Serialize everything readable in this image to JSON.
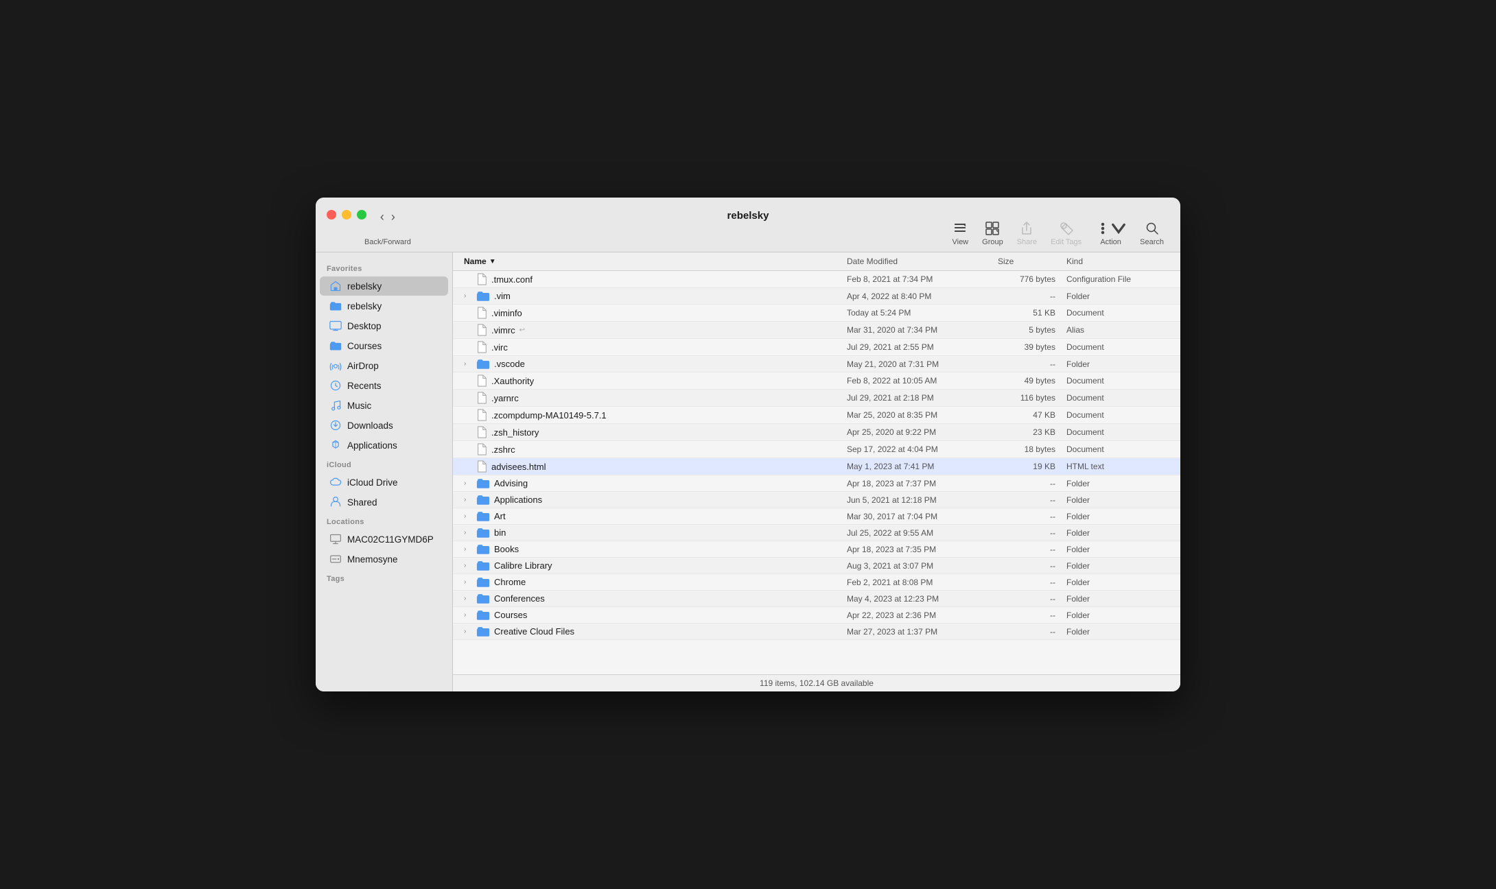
{
  "window": {
    "title": "rebelsky"
  },
  "toolbar": {
    "back_forward_label": "Back/Forward",
    "view_label": "View",
    "group_label": "Group",
    "share_label": "Share",
    "edit_tags_label": "Edit Tags",
    "action_label": "Action",
    "search_label": "Search"
  },
  "sidebar": {
    "favorites_label": "Favorites",
    "icloud_label": "iCloud",
    "locations_label": "Locations",
    "tags_label": "Tags",
    "items": [
      {
        "id": "rebelsky-home",
        "label": "rebelsky",
        "type": "home",
        "active": true
      },
      {
        "id": "rebelsky-folder",
        "label": "rebelsky",
        "type": "folder",
        "active": false
      },
      {
        "id": "desktop",
        "label": "Desktop",
        "type": "desktop",
        "active": false
      },
      {
        "id": "courses",
        "label": "Courses",
        "type": "folder",
        "active": false
      },
      {
        "id": "airdrop",
        "label": "AirDrop",
        "type": "airdrop",
        "active": false
      },
      {
        "id": "recents",
        "label": "Recents",
        "type": "recents",
        "active": false
      },
      {
        "id": "music",
        "label": "Music",
        "type": "music",
        "active": false
      },
      {
        "id": "downloads",
        "label": "Downloads",
        "type": "downloads",
        "active": false
      },
      {
        "id": "applications",
        "label": "Applications",
        "type": "applications",
        "active": false
      }
    ],
    "icloud_items": [
      {
        "id": "icloud-drive",
        "label": "iCloud Drive",
        "type": "cloud"
      },
      {
        "id": "shared",
        "label": "Shared",
        "type": "shared"
      }
    ],
    "location_items": [
      {
        "id": "mac",
        "label": "MAC02C11GYMD6P",
        "type": "computer"
      },
      {
        "id": "mnemosyne",
        "label": "Mnemosyne",
        "type": "drive"
      }
    ]
  },
  "columns": {
    "name": "Name",
    "date_modified": "Date Modified",
    "size": "Size",
    "kind": "Kind"
  },
  "files": [
    {
      "name": ".tmux.conf",
      "date": "Feb 8, 2021 at 7:34 PM",
      "size": "776 bytes",
      "kind": "Configuration File",
      "type": "doc",
      "expanded": false
    },
    {
      "name": ".vim",
      "date": "Apr 4, 2022 at 8:40 PM",
      "size": "--",
      "kind": "Folder",
      "type": "folder",
      "expanded": false
    },
    {
      "name": ".viminfo",
      "date": "Today at 5:24 PM",
      "size": "51 KB",
      "kind": "Document",
      "type": "doc",
      "expanded": false
    },
    {
      "name": ".vimrc",
      "date": "Mar 31, 2020 at 7:34 PM",
      "size": "5 bytes",
      "kind": "Alias",
      "type": "alias",
      "expanded": false
    },
    {
      "name": ".virc",
      "date": "Jul 29, 2021 at 2:55 PM",
      "size": "39 bytes",
      "kind": "Document",
      "type": "doc",
      "expanded": false
    },
    {
      "name": ".vscode",
      "date": "May 21, 2020 at 7:31 PM",
      "size": "--",
      "kind": "Folder",
      "type": "folder",
      "expanded": false
    },
    {
      "name": ".Xauthority",
      "date": "Feb 8, 2022 at 10:05 AM",
      "size": "49 bytes",
      "kind": "Document",
      "type": "doc",
      "expanded": false
    },
    {
      "name": ".yarnrc",
      "date": "Jul 29, 2021 at 2:18 PM",
      "size": "116 bytes",
      "kind": "Document",
      "type": "doc",
      "expanded": false
    },
    {
      "name": ".zcompdump-MA10149-5.7.1",
      "date": "Mar 25, 2020 at 8:35 PM",
      "size": "47 KB",
      "kind": "Document",
      "type": "doc",
      "expanded": false
    },
    {
      "name": ".zsh_history",
      "date": "Apr 25, 2020 at 9:22 PM",
      "size": "23 KB",
      "kind": "Document",
      "type": "doc",
      "expanded": false
    },
    {
      "name": ".zshrc",
      "date": "Sep 17, 2022 at 4:04 PM",
      "size": "18 bytes",
      "kind": "Document",
      "type": "doc",
      "expanded": false
    },
    {
      "name": "advisees.html",
      "date": "May 1, 2023 at 7:41 PM",
      "size": "19 KB",
      "kind": "HTML text",
      "type": "html",
      "expanded": false,
      "highlighted": true
    },
    {
      "name": "Advising",
      "date": "Apr 18, 2023 at 7:37 PM",
      "size": "--",
      "kind": "Folder",
      "type": "folder",
      "expanded": false
    },
    {
      "name": "Applications",
      "date": "Jun 5, 2021 at 12:18 PM",
      "size": "--",
      "kind": "Folder",
      "type": "folder",
      "expanded": false
    },
    {
      "name": "Art",
      "date": "Mar 30, 2017 at 7:04 PM",
      "size": "--",
      "kind": "Folder",
      "type": "folder",
      "expanded": false
    },
    {
      "name": "bin",
      "date": "Jul 25, 2022 at 9:55 AM",
      "size": "--",
      "kind": "Folder",
      "type": "folder",
      "expanded": false
    },
    {
      "name": "Books",
      "date": "Apr 18, 2023 at 7:35 PM",
      "size": "--",
      "kind": "Folder",
      "type": "folder",
      "expanded": false
    },
    {
      "name": "Calibre Library",
      "date": "Aug 3, 2021 at 3:07 PM",
      "size": "--",
      "kind": "Folder",
      "type": "folder",
      "expanded": false
    },
    {
      "name": "Chrome",
      "date": "Feb 2, 2021 at 8:08 PM",
      "size": "--",
      "kind": "Folder",
      "type": "folder",
      "expanded": false
    },
    {
      "name": "Conferences",
      "date": "May 4, 2023 at 12:23 PM",
      "size": "--",
      "kind": "Folder",
      "type": "folder",
      "expanded": false
    },
    {
      "name": "Courses",
      "date": "Apr 22, 2023 at 2:36 PM",
      "size": "--",
      "kind": "Folder",
      "type": "folder",
      "expanded": false
    },
    {
      "name": "Creative Cloud Files",
      "date": "Mar 27, 2023 at 1:37 PM",
      "size": "--",
      "kind": "Folder",
      "type": "folder",
      "expanded": false
    }
  ],
  "status_bar": {
    "text": "119 items, 102.14 GB available"
  }
}
